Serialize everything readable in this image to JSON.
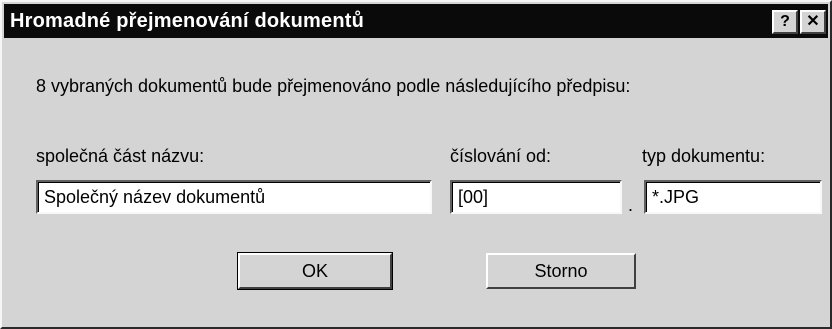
{
  "dialog": {
    "title": "Hromadné přejmenování dokumentů",
    "help_label": "?",
    "close_label": "✕",
    "message": "8 vybraných dokumentů bude přejmenováno podle následujícího předpisu:"
  },
  "fields": {
    "name_label": "společná část názvu:",
    "name_value": "Společný název dokumentů",
    "number_label": "číslování od:",
    "number_value": "[00]",
    "separator": ".",
    "type_label": "typ dokumentu:",
    "type_value": "*.JPG"
  },
  "buttons": {
    "ok_label": "OK",
    "cancel_label": "Storno"
  }
}
